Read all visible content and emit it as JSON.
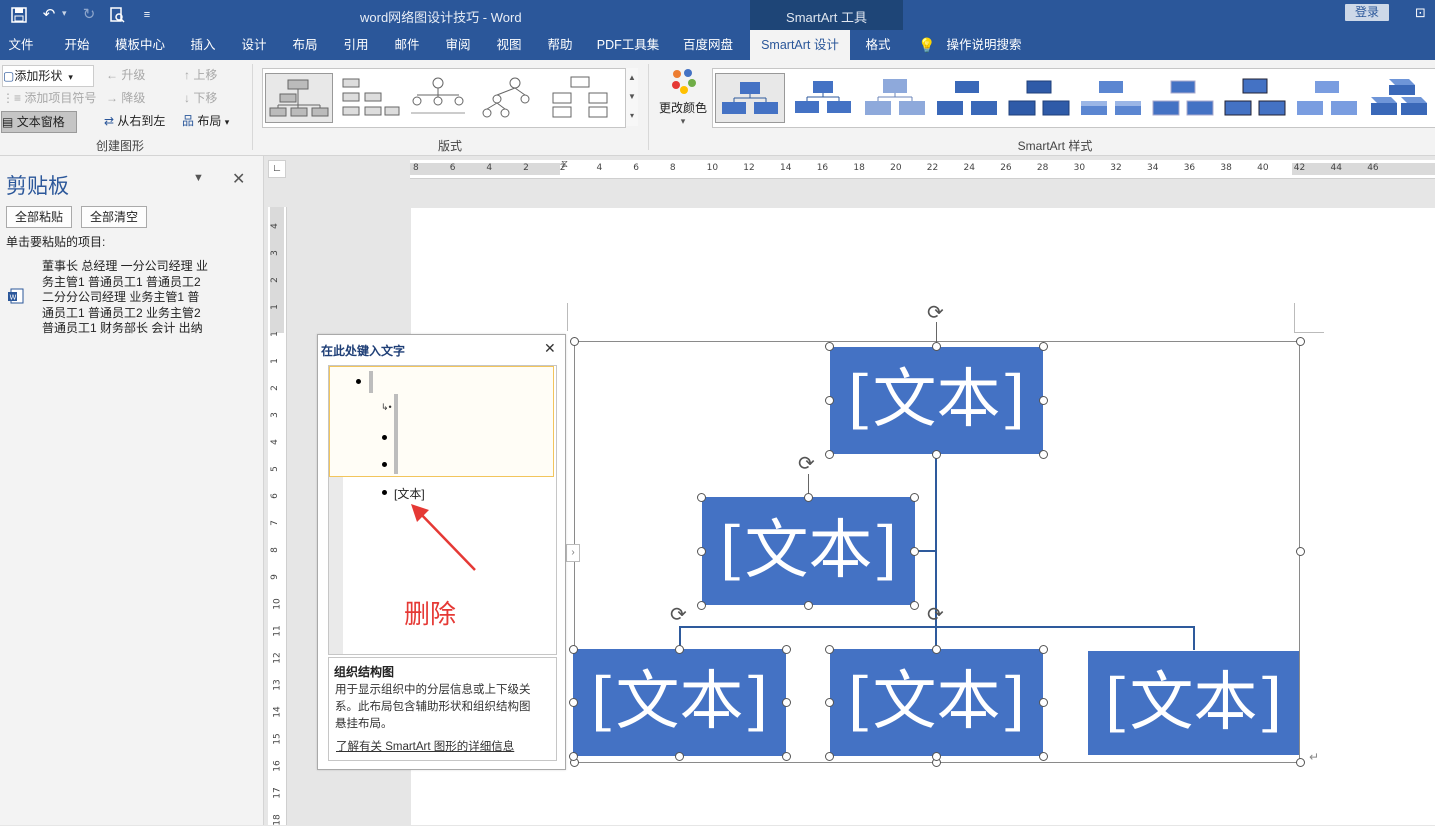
{
  "titlebar": {
    "doc_title": "word网络图设计技巧  -  Word",
    "context_tab": "SmartArt 工具",
    "login_label": "登录",
    "quick_icons": [
      "save-icon",
      "undo-icon",
      "redo-icon",
      "print-preview-icon",
      "customize-icon"
    ]
  },
  "tabs": [
    "文件",
    "开始",
    "模板中心",
    "插入",
    "设计",
    "布局",
    "引用",
    "邮件",
    "审阅",
    "视图",
    "帮助",
    "PDF工具集",
    "百度网盘",
    "SmartArt 设计",
    "格式"
  ],
  "active_tab": "SmartArt 设计",
  "search_hint": "操作说明搜索",
  "ribbon": {
    "create": {
      "add_shape": "添加形状",
      "add_bullet": "添加项目符号",
      "text_pane": "文本窗格",
      "promote": "升级",
      "demote": "降级",
      "right_to_left": "从右到左",
      "move_up": "上移",
      "move_down": "下移",
      "layout": "布局",
      "group_label": "创建图形"
    },
    "layouts_label": "版式",
    "change_colors": "更改颜色",
    "styles_label": "SmartArt 样式"
  },
  "clipboard": {
    "title": "剪贴板",
    "paste_all": "全部粘贴",
    "clear_all": "全部清空",
    "instruction": "单击要粘贴的项目:",
    "item_lines": [
      "董事长 总经理 一分公司经理 业",
      "务主管1 普通员工1 普通员工2",
      "二分分公司经理 业务主管1 普",
      "通员工1 普通员工2 业务主管2",
      "普通员工1 财务部长 会计 出纳"
    ]
  },
  "ruler": {
    "h_labels": [
      "8",
      "6",
      "4",
      "2",
      "2",
      "4",
      "6",
      "8",
      "10",
      "12",
      "14",
      "16",
      "18",
      "20",
      "22",
      "24",
      "26",
      "28",
      "30",
      "32",
      "34",
      "36",
      "38",
      "40",
      "42",
      "44",
      "46"
    ],
    "v_labels": [
      "4",
      "3",
      "2",
      "1",
      "1",
      "1",
      "2",
      "3",
      "4",
      "5",
      "6",
      "7",
      "8",
      "9",
      "10",
      "11",
      "12",
      "13",
      "14",
      "15",
      "16",
      "17",
      "18"
    ]
  },
  "textpane": {
    "title": "在此处键入文字",
    "bullet_text": "[文本]",
    "annotation": "删除",
    "layout_title": "组织结构图",
    "description_lines": [
      "用于显示组织中的分层信息或上下级关",
      "系。此布局包含辅助形状和组织结构图",
      "悬挂布局。"
    ],
    "learn_more": "了解有关 SmartArt 图形的详细信息"
  },
  "smartart": {
    "box_text": "[文本]",
    "box_color": "#4472c4"
  },
  "colors": {
    "brand": "#2b579a",
    "annotation_red": "#e53935"
  }
}
